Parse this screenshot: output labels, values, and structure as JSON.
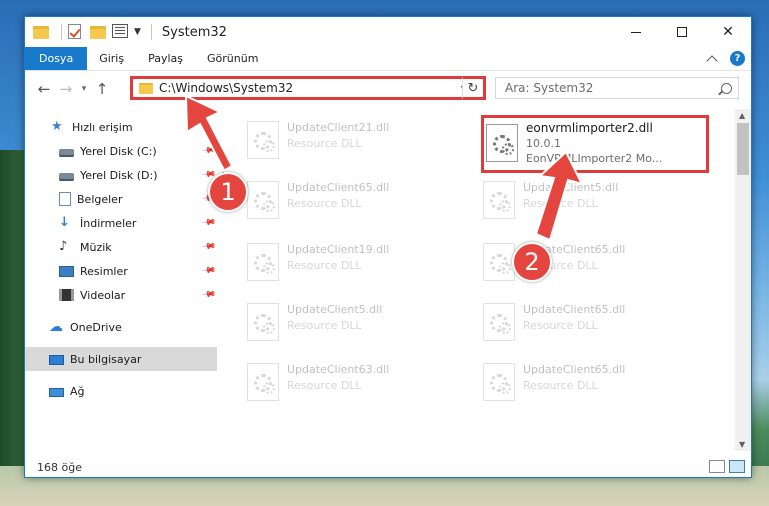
{
  "window": {
    "title": "System32"
  },
  "ribbon": {
    "tabs": [
      "Dosya",
      "Giriş",
      "Paylaş",
      "Görünüm"
    ],
    "help": "?"
  },
  "address": {
    "path": "C:\\Windows\\System32",
    "search_placeholder": "Ara: System32"
  },
  "sidebar": {
    "items": [
      {
        "label": "Hızlı erişim",
        "icon": "star-icon"
      },
      {
        "label": "Yerel Disk (C:)",
        "icon": "disk-icon"
      },
      {
        "label": "Yerel Disk (D:)",
        "icon": "disk-icon"
      },
      {
        "label": "Belgeler",
        "icon": "documents-icon"
      },
      {
        "label": "İndirmeler",
        "icon": "downloads-icon"
      },
      {
        "label": "Müzik",
        "icon": "music-icon"
      },
      {
        "label": "Resimler",
        "icon": "pictures-icon"
      },
      {
        "label": "Videolar",
        "icon": "videos-icon"
      },
      {
        "label": "OneDrive",
        "icon": "cloud-icon"
      },
      {
        "label": "Bu bilgisayar",
        "icon": "computer-icon"
      },
      {
        "label": "Ağ",
        "icon": "network-icon"
      }
    ]
  },
  "files": [
    {
      "name": "UpdateClient21.dll",
      "type": "Resource DLL"
    },
    {
      "name": "UpdateClient65.dll",
      "type": "Resource DLL"
    },
    {
      "name": "UpdateClient5.dll",
      "type": "Resource DLL"
    },
    {
      "name": "UpdateClient19.dll",
      "type": "Resource DLL"
    },
    {
      "name": "UpdateClient65.dll",
      "type": "Resource DLL"
    },
    {
      "name": "UpdateClient5.dll",
      "type": "Resource DLL"
    },
    {
      "name": "UpdateClient65.dll",
      "type": "Resource DLL"
    },
    {
      "name": "UpdateClient63.dll",
      "type": "Resource DLL"
    },
    {
      "name": "UpdateClient65.dll",
      "type": "Resource DLL"
    }
  ],
  "selected_file": {
    "name": "eonvrmlimporter2.dll",
    "version": "10.0.1",
    "description": "EonVRMLImporter2 Mo..."
  },
  "status": {
    "item_count": "168 öğe"
  },
  "annotations": {
    "badge1": "1",
    "badge2": "2",
    "color": "#e4463f"
  }
}
